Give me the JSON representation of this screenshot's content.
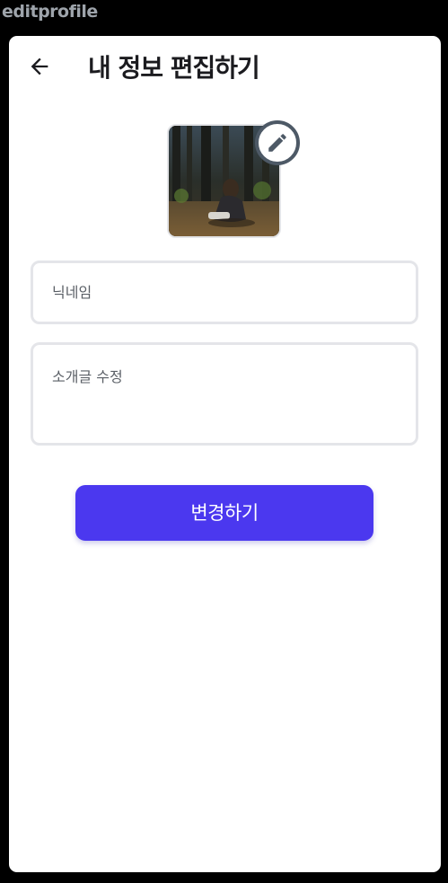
{
  "frame": {
    "label": "editprofile"
  },
  "header": {
    "back_icon": "arrow-left-icon",
    "title": "내 정보 편집하기"
  },
  "profile": {
    "edit_icon": "pencil-icon"
  },
  "form": {
    "nickname": {
      "value": "",
      "placeholder": "닉네임"
    },
    "bio": {
      "value": "",
      "placeholder": "소개글 수정"
    },
    "submit_label": "변경하기"
  },
  "colors": {
    "primary": "#4b38ef",
    "field_border": "#e4e5e9",
    "edit_badge_border": "#4d5966",
    "title_text": "#1b1b1f",
    "background": "#000000",
    "screen": "#ffffff"
  }
}
